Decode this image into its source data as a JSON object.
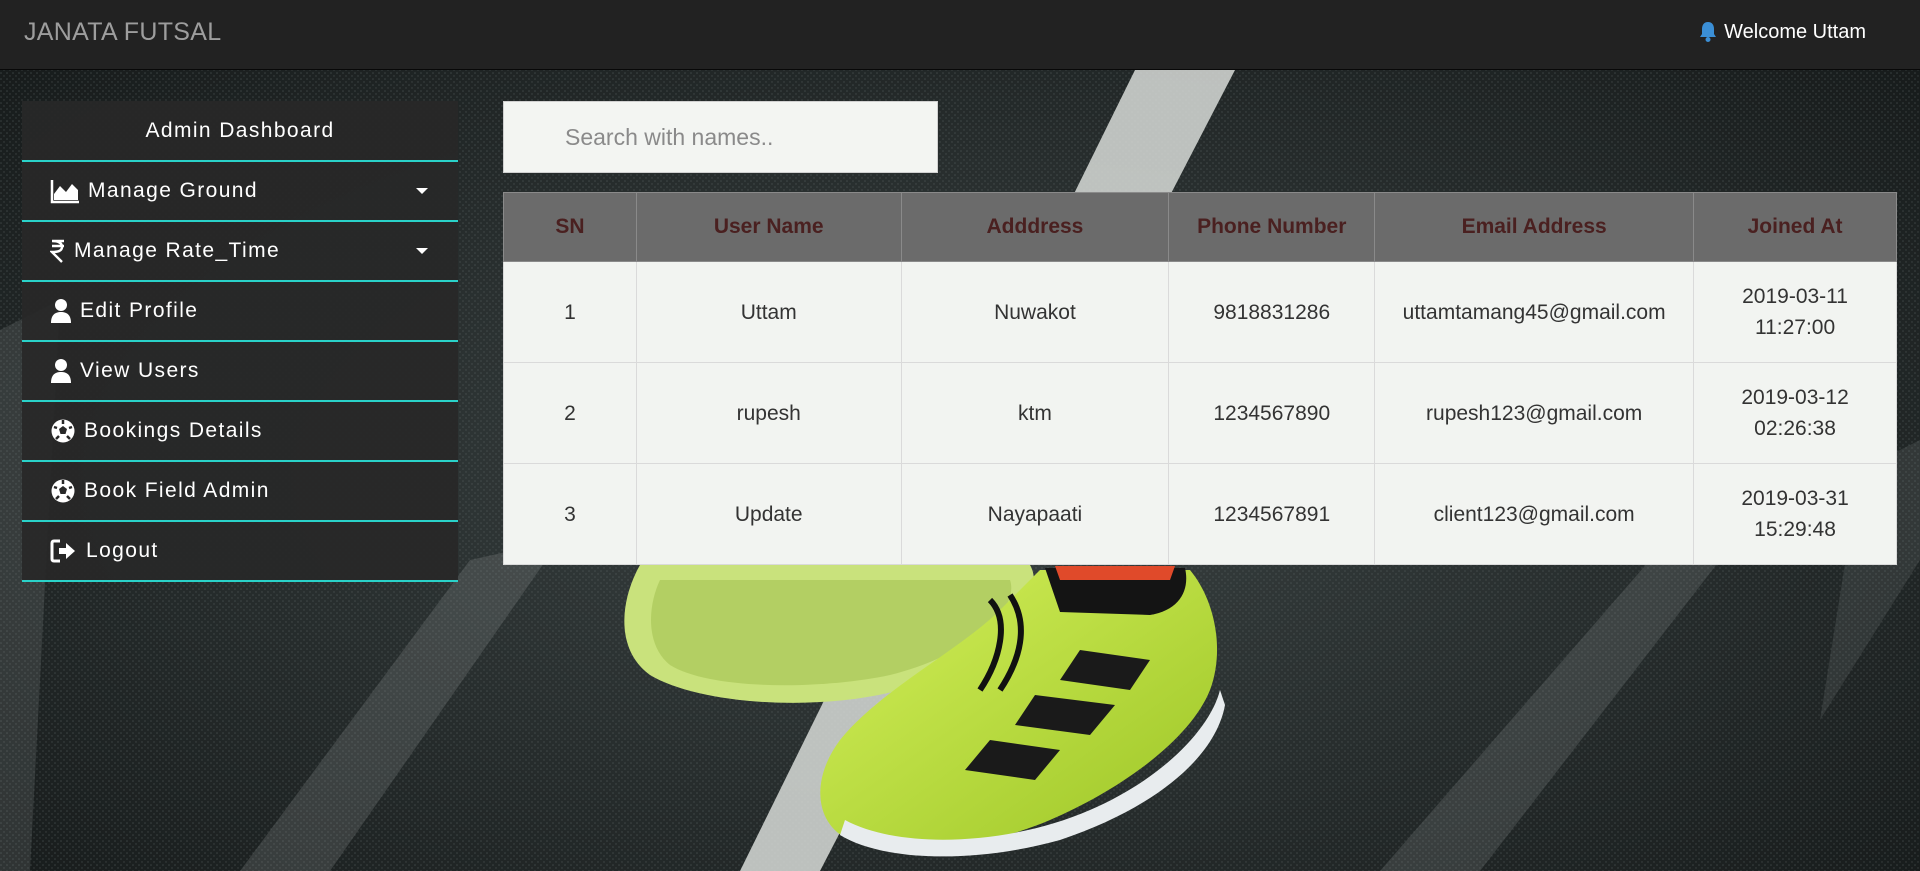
{
  "navbar": {
    "brand": "JANATA FUTSAL",
    "welcome": "Welcome Uttam"
  },
  "sidebar": {
    "title": "Admin Dashboard",
    "items": [
      {
        "label": "Manage Ground",
        "icon": "area-chart-icon",
        "dropdown": true
      },
      {
        "label": "Manage Rate_Time",
        "icon": "rupee-icon",
        "dropdown": true
      },
      {
        "label": "Edit Profile",
        "icon": "user-icon",
        "dropdown": false
      },
      {
        "label": "View Users",
        "icon": "user-icon",
        "dropdown": false
      },
      {
        "label": "Bookings Details",
        "icon": "soccer-ball-icon",
        "dropdown": false
      },
      {
        "label": "Book Field Admin",
        "icon": "soccer-ball-icon",
        "dropdown": false
      },
      {
        "label": "Logout",
        "icon": "sign-out-icon",
        "dropdown": false
      }
    ]
  },
  "search": {
    "placeholder": "Search with names..",
    "value": ""
  },
  "table": {
    "headers": [
      "SN",
      "User Name",
      "Adddress",
      "Phone Number",
      "Email Address",
      "Joined At"
    ],
    "rows": [
      {
        "sn": "1",
        "name": "Uttam",
        "address": "Nuwakot",
        "phone": "9818831286",
        "email": "uttamtamang45@gmail.com",
        "joined_date": "2019-03-11",
        "joined_time": "11:27:00"
      },
      {
        "sn": "2",
        "name": "rupesh",
        "address": "ktm",
        "phone": "1234567890",
        "email": "rupesh123@gmail.com",
        "joined_date": "2019-03-12",
        "joined_time": "02:26:38"
      },
      {
        "sn": "3",
        "name": "Update",
        "address": "Nayapaati",
        "phone": "1234567891",
        "email": "client123@gmail.com",
        "joined_date": "2019-03-31",
        "joined_time": "15:29:48"
      }
    ]
  },
  "colors": {
    "navbar_bg": "#222222",
    "accent": "#2ad2c9",
    "table_header_bg": "#6b6b6b",
    "table_header_text": "#4a2020",
    "bell": "#3b8fd6"
  }
}
